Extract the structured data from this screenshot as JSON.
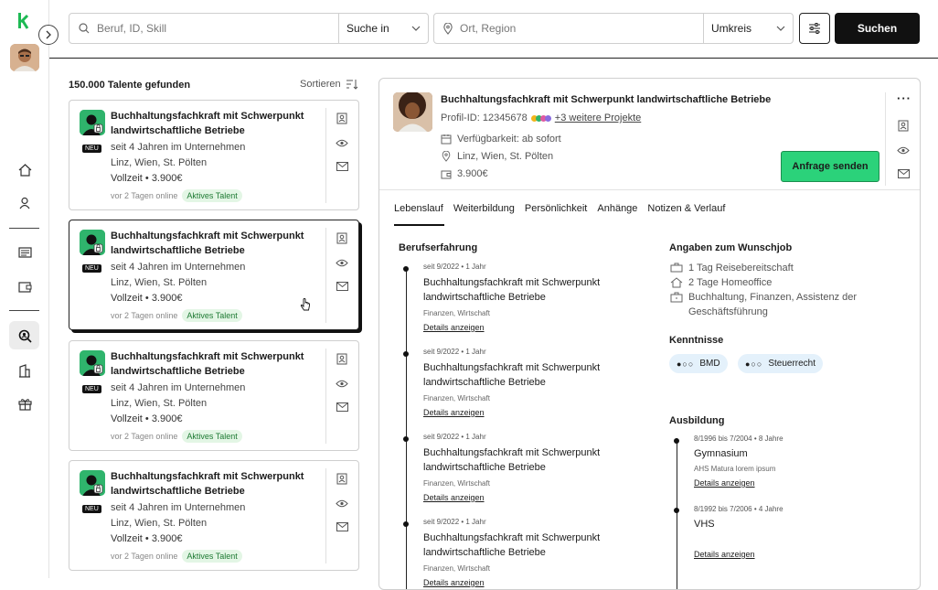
{
  "search": {
    "job_placeholder": "Beruf, ID, Skill",
    "search_in_label": "Suche in",
    "location_placeholder": "Ort, Region",
    "radius_label": "Umkreis",
    "search_button": "Suchen"
  },
  "results": {
    "count_label": "150.000 Talente gefunden",
    "sort_label": "Sortieren",
    "cards": [
      {
        "title": "Buchhaltungsfachkraft mit Schwerpunkt landwirtschaftliche Betriebe",
        "badge": "NEU",
        "tenure": "seit  4 Jahren im Unternehmen",
        "locations": "Linz, Wien, St. Pölten",
        "terms": "Vollzeit • 3.900€",
        "online": "vor 2 Tagen online",
        "status": "Aktives Talent"
      },
      {
        "title": "Buchhaltungsfachkraft mit Schwerpunkt landwirtschaftliche Betriebe",
        "badge": "NEU",
        "tenure": "seit  4 Jahren im Unternehmen",
        "locations": "Linz, Wien, St. Pölten",
        "terms": "Vollzeit • 3.900€",
        "online": "vor 2 Tagen online",
        "status": "Aktives Talent"
      },
      {
        "title": "Buchhaltungsfachkraft mit Schwerpunkt landwirtschaftliche Betriebe",
        "badge": "NEU",
        "tenure": "seit  4 Jahren im Unternehmen",
        "locations": "Linz, Wien, St. Pölten",
        "terms": "Vollzeit • 3.900€",
        "online": "vor 2 Tagen online",
        "status": "Aktives Talent"
      },
      {
        "title": "Buchhaltungsfachkraft mit Schwerpunkt landwirtschaftliche Betriebe",
        "badge": "NEU",
        "tenure": "seit  4 Jahren im Unternehmen",
        "locations": "Linz, Wien, St. Pölten",
        "terms": "Vollzeit • 3.900€",
        "online": "vor 2 Tagen online",
        "status": "Aktives Talent"
      }
    ]
  },
  "detail": {
    "title": "Buchhaltungsfachkraft mit Schwerpunkt landwirtschaftliche Betriebe",
    "profile_id": "Profil-ID: 12345678",
    "more_projects": "+3 weitere Projekte",
    "availability": "Verfügbarkeit: ab sofort",
    "locations": "Linz, Wien, St. Pölten",
    "salary": "3.900€",
    "request_button": "Anfrage senden",
    "tabs": [
      "Lebenslauf",
      "Weiterbildung",
      "Persönlichkeit",
      "Anhänge",
      "Notizen & Verlauf"
    ],
    "experience_heading": "Berufserfahrung",
    "experience": [
      {
        "date": "seit 9/2022 • 1 Jahr",
        "title": "Buchhaltungsfachkraft mit Schwerpunkt landwirtschaftliche Betriebe",
        "category": "Finanzen, Wirtschaft",
        "link": "Details anzeigen"
      },
      {
        "date": "seit 9/2022 • 1 Jahr",
        "title": "Buchhaltungsfachkraft mit Schwerpunkt landwirtschaftliche Betriebe",
        "category": "Finanzen, Wirtschaft",
        "link": "Details anzeigen"
      },
      {
        "date": "seit 9/2022 • 1 Jahr",
        "title": "Buchhaltungsfachkraft mit Schwerpunkt landwirtschaftliche Betriebe",
        "category": "Finanzen, Wirtschaft",
        "link": "Details anzeigen"
      },
      {
        "date": "seit 9/2022 • 1 Jahr",
        "title": "Buchhaltungsfachkraft mit Schwerpunkt landwirtschaftliche Betriebe",
        "category": "Finanzen, Wirtschaft",
        "link": "Details anzeigen"
      }
    ],
    "wish_heading": "Angaben zum Wunschjob",
    "wish": [
      "1 Tag Reisebereitschaft",
      "2 Tage Homeoffice",
      "Buchhaltung, Finanzen, Assistenz der Geschäftsführung"
    ],
    "skills_heading": "Kenntnisse",
    "skills": [
      {
        "dots": "●○○",
        "name": "BMD"
      },
      {
        "dots": "●○○",
        "name": "Steuerrecht"
      }
    ],
    "education_heading": "Ausbildung",
    "education": [
      {
        "date": "8/1996 bis 7/2004 • 8 Jahre",
        "title": "Gymnasium",
        "detail": "AHS Matura lorem ipsum",
        "link": "Details anzeigen"
      },
      {
        "date": "8/1992 bis 7/2006 • 4 Jahre",
        "title": "VHS",
        "detail": "",
        "link": "Details anzeigen"
      }
    ]
  },
  "colors": {
    "accent": "#2bd27a",
    "brand_logo": "#1db954",
    "tag_bg": "#e3f6e5",
    "skill_bg": "#e4f1fb"
  }
}
